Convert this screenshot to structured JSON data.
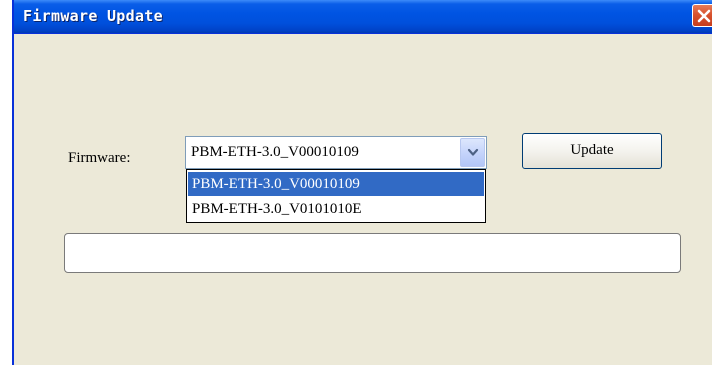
{
  "window": {
    "title": "Firmware Update"
  },
  "form": {
    "firmware_label": "Firmware:",
    "selected_value": "PBM-ETH-3.0_V00010109",
    "options": [
      "PBM-ETH-3.0_V00010109",
      "PBM-ETH-3.0_V0101010E"
    ],
    "update_label": "Update"
  },
  "progress": {
    "value": ""
  },
  "icons": {
    "close": "close-icon",
    "dropdown": "chevron-down-icon"
  },
  "colors": {
    "titlebar": "#0054e3",
    "close_button": "#d8532f",
    "selection": "#316ac5",
    "window_bg": "#ece9d8"
  }
}
